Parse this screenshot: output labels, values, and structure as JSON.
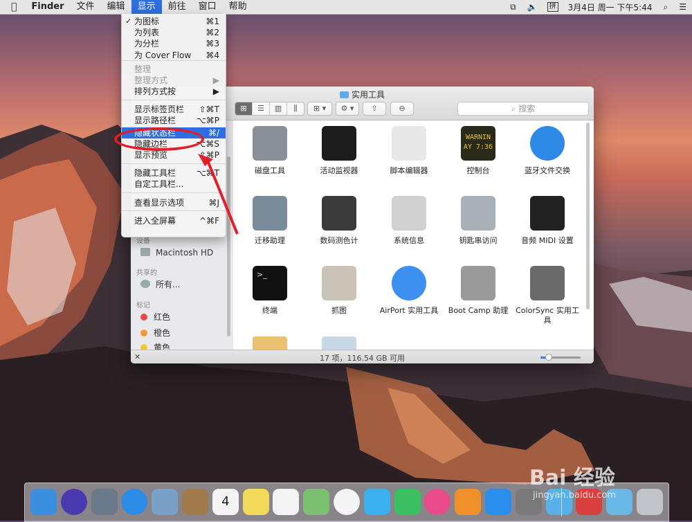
{
  "menubar": {
    "apple": "",
    "app_name": "Finder",
    "items": [
      "文件",
      "编辑",
      "显示",
      "前往",
      "窗口",
      "帮助"
    ],
    "active_index": 2,
    "clock": "3月4日 周一 下午5:44",
    "input_method": "拼"
  },
  "view_menu": {
    "items": [
      {
        "check": "✓",
        "label": "为图标",
        "shortcut": "⌘1"
      },
      {
        "check": "",
        "label": "为列表",
        "shortcut": "⌘2"
      },
      {
        "check": "",
        "label": "为分栏",
        "shortcut": "⌘3"
      },
      {
        "check": "",
        "label": "为 Cover Flow",
        "shortcut": "⌘4"
      },
      {
        "check": "",
        "label": "整理",
        "shortcut": ""
      },
      {
        "check": "",
        "label": "整理方式",
        "shortcut": "▶"
      },
      {
        "check": "",
        "label": "排列方式按",
        "shortcut": "▶"
      },
      {
        "check": "",
        "label": "显示标签页栏",
        "shortcut": "⇧⌘T"
      },
      {
        "check": "",
        "label": "显示路径栏",
        "shortcut": "⌥⌘P"
      },
      {
        "check": "",
        "label": "隐藏状态栏",
        "shortcut": "⌘/"
      },
      {
        "check": "",
        "label": "隐藏边栏",
        "shortcut": "⌥⌘S"
      },
      {
        "check": "",
        "label": "显示预览",
        "shortcut": "⇧⌘P"
      },
      {
        "check": "",
        "label": "隐藏工具栏",
        "shortcut": "⌥⌘T"
      },
      {
        "check": "",
        "label": "自定工具栏...",
        "shortcut": ""
      },
      {
        "check": "",
        "label": "查看显示选项",
        "shortcut": "⌘J"
      },
      {
        "check": "",
        "label": "进入全屏幕",
        "shortcut": "^⌘F"
      }
    ]
  },
  "finder_window": {
    "title": "实用工具",
    "search_placeholder": "搜索",
    "view_modes": [
      "⊞",
      "☰",
      "▥",
      "⫼"
    ],
    "sidebar": {
      "devices_header": "设备",
      "device": "Macintosh HD",
      "shared_header": "共享的",
      "shared_item": "所有...",
      "tags_header": "标记",
      "tags": [
        {
          "label": "红色",
          "color": "#e84b4b"
        },
        {
          "label": "橙色",
          "color": "#f39a2f"
        },
        {
          "label": "黄色",
          "color": "#f3c72f"
        }
      ]
    },
    "apps": [
      {
        "name": "磁盘工具",
        "color": "#8a9098"
      },
      {
        "name": "活动监视器",
        "color": "#1c1c1c"
      },
      {
        "name": "脚本编辑器",
        "color": "#e8e8e8"
      },
      {
        "name": "控制台",
        "color": "#2a2a1a"
      },
      {
        "name": "蓝牙文件交换",
        "color": "#2e8ae6"
      },
      {
        "name": "迁移助理",
        "color": "#7a8c9c"
      },
      {
        "name": "数码测色计",
        "color": "#3a3a3a"
      },
      {
        "name": "系统信息",
        "color": "#d0d0d0"
      },
      {
        "name": "钥匙串访问",
        "color": "#a8b0b8"
      },
      {
        "name": "音频 MIDI 设置",
        "color": "#222222"
      },
      {
        "name": "终端",
        "color": "#111111"
      },
      {
        "name": "抓图",
        "color": "#c9c3b8"
      },
      {
        "name": "AirPort 实用工具",
        "color": "#3d8ff0"
      },
      {
        "name": "Boot Camp 助理",
        "color": "#9a9a9a"
      },
      {
        "name": "ColorSync 实用工具",
        "color": "#6a6a6a"
      }
    ],
    "console_text": "WARNIN",
    "console_text2": "AY 7:36",
    "status": "17 项，116.54 GB 可用",
    "zoom_level": 0.2
  },
  "dock": {
    "icons": [
      {
        "name": "finder-icon",
        "color": "#3a8fe0"
      },
      {
        "name": "siri-icon",
        "color": "#4a3ab0"
      },
      {
        "name": "launchpad-icon",
        "color": "#6a7a8a"
      },
      {
        "name": "safari-icon",
        "color": "#2d8ce6"
      },
      {
        "name": "mail-icon",
        "color": "#7aa0c8"
      },
      {
        "name": "contacts-icon",
        "color": "#a07a4a"
      },
      {
        "name": "calendar-icon",
        "color": "#f4f4f4"
      },
      {
        "name": "notes-icon",
        "color": "#f3d95a"
      },
      {
        "name": "reminders-icon",
        "color": "#f4f4f4"
      },
      {
        "name": "maps-icon",
        "color": "#7ac070"
      },
      {
        "name": "photos-icon",
        "color": "#f4f4f4"
      },
      {
        "name": "messages-icon",
        "color": "#3ab0f0"
      },
      {
        "name": "facetime-icon",
        "color": "#3ac060"
      },
      {
        "name": "itunes-icon",
        "color": "#e84a8a"
      },
      {
        "name": "ibooks-icon",
        "color": "#f0902a"
      },
      {
        "name": "appstore-icon",
        "color": "#2a90f0"
      },
      {
        "name": "system-preferences-icon",
        "color": "#7a7a7a"
      },
      {
        "name": "folder-icon",
        "color": "#5ab0e8"
      },
      {
        "name": "app-icon",
        "color": "#d84040"
      },
      {
        "name": "downloads-icon",
        "color": "#6ab8e8"
      },
      {
        "name": "trash-icon",
        "color": "#c0c4c8"
      }
    ],
    "calendar_day": "4"
  },
  "watermark": {
    "brand": "Bai 经验",
    "url": "jingyan.baidu.com"
  }
}
